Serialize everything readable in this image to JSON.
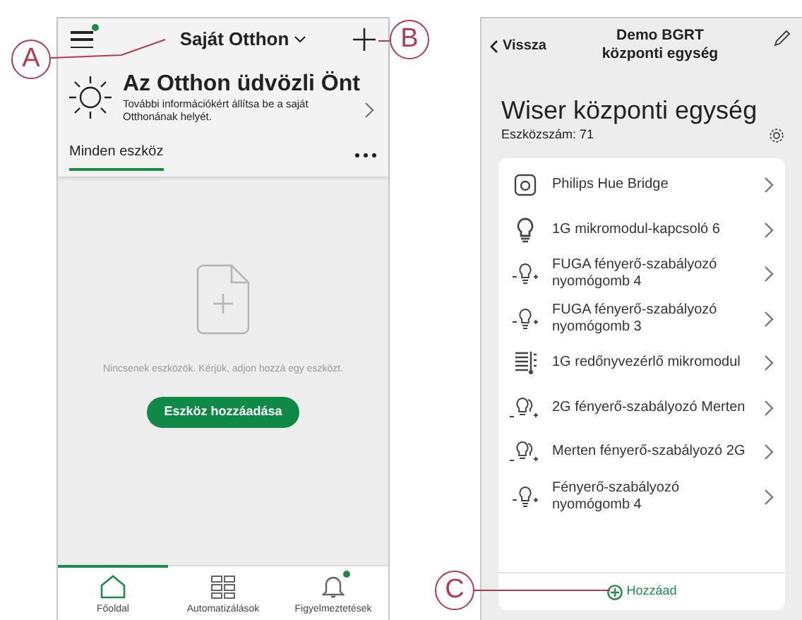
{
  "home_screen": {
    "menu_badge": true,
    "title": "Saját Otthon",
    "welcome": {
      "heading": "Az Otthon üdvözli Önt",
      "text": "További információkért állítsa be a saját Otthonának helyét."
    },
    "filter": {
      "label": "Minden eszköz",
      "selected": true
    },
    "empty_message": "Nincsenek eszközök. Kérjük, adjon hozzá egy eszközt.",
    "add_button": "Eszköz hozzáadása",
    "tabs": [
      {
        "label": "Főoldal",
        "kind": "home",
        "selected": true,
        "badge": false
      },
      {
        "label": "Automatizálások",
        "kind": "grid",
        "selected": false,
        "badge": false
      },
      {
        "label": "Figyelmeztetések",
        "kind": "bell",
        "selected": false,
        "badge": true
      }
    ]
  },
  "hub_screen": {
    "back": "Vissza",
    "title": "Demo BGRT központi egység",
    "heading": "Wiser központi egység",
    "count": "Eszközszám: 71",
    "devices": [
      {
        "name": "Philips Hue Bridge",
        "kind": "hub"
      },
      {
        "name": "1G mikromodul-kapcsoló 6",
        "kind": "bulb"
      },
      {
        "name": "FUGA fényerő-szabályozó nyomógomb 4",
        "kind": "dimmer"
      },
      {
        "name": "FUGA fényerő-szabályozó nyomógomb 3",
        "kind": "dimmer"
      },
      {
        "name": "1G redőnyvezérlő mikromodul",
        "kind": "shutter"
      },
      {
        "name": "2G fényerő-szabályozó Merten",
        "kind": "dimmer2"
      },
      {
        "name": "Merten fényerő-szabályozó 2G",
        "kind": "dimmer2"
      },
      {
        "name": "Fényerő-szabályozó nyomógomb 4",
        "kind": "dimmer"
      }
    ],
    "add": "Hozzáad"
  },
  "callouts": [
    "A",
    "B",
    "C"
  ]
}
